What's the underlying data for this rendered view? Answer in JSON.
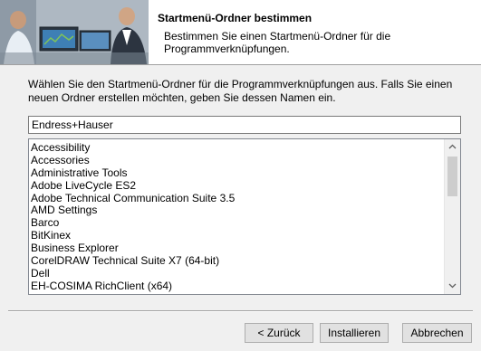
{
  "header": {
    "title": "Startmenü-Ordner bestimmen",
    "subtitle": "Bestimmen Sie einen Startmenü-Ordner für die Programmverknüpfungen."
  },
  "main": {
    "description": "Wählen Sie den Startmenü-Ordner für die Programmverknüpfungen aus. Falls Sie einen neuen Ordner erstellen möchten, geben Sie dessen Namen ein.",
    "folder_value": "Endress+Hauser",
    "folders": [
      "Accessibility",
      "Accessories",
      "Administrative Tools",
      "Adobe LiveCycle ES2",
      "Adobe Technical Communication Suite 3.5",
      "AMD Settings",
      "Barco",
      "BitKinex",
      "Business Explorer",
      "CorelDRAW Technical Suite X7 (64-bit)",
      "Dell",
      "EH-COSIMA RichClient (x64)"
    ],
    "scroll_up_icon": "chevron-up-icon",
    "scroll_down_icon": "chevron-down-icon"
  },
  "buttons": {
    "back": "< Zurück",
    "install": "Installieren",
    "cancel": "Abbrechen"
  }
}
